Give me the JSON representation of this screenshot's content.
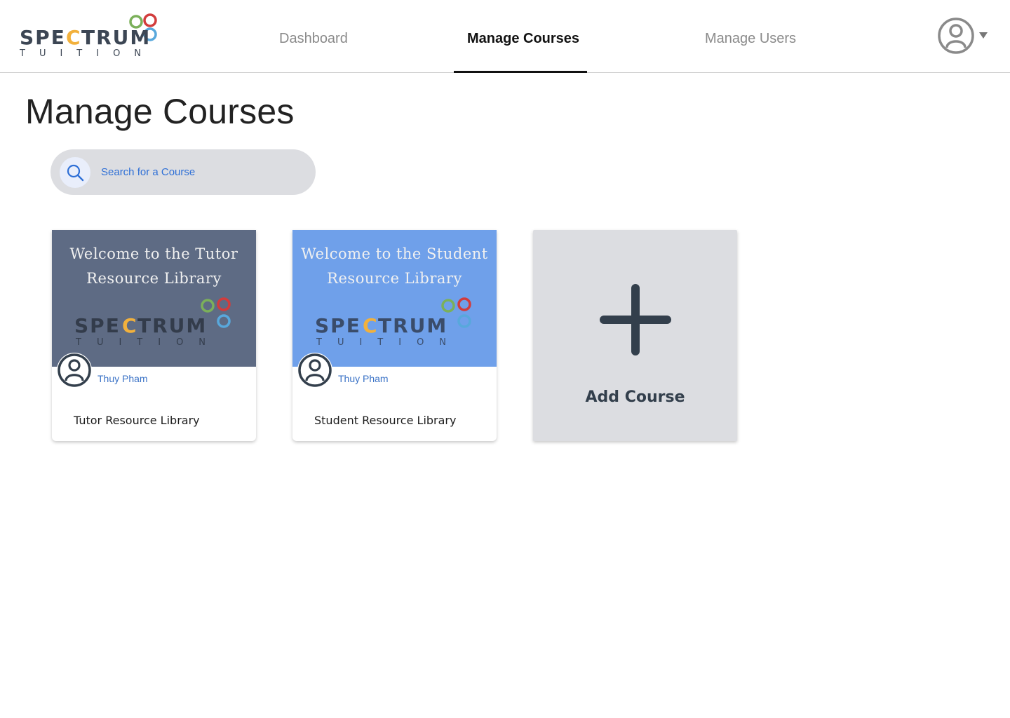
{
  "brand": {
    "name": "SPECTRUM",
    "sub": "TUITION",
    "colors": {
      "green": "#7bb05a",
      "red": "#d23c3c",
      "blue": "#58a8dc",
      "yellow": "#f2b13c",
      "dark": "#3c4654"
    }
  },
  "nav": {
    "items": [
      {
        "label": "Dashboard",
        "active": false
      },
      {
        "label": "Manage Courses",
        "active": true
      },
      {
        "label": "Manage Users",
        "active": false
      }
    ]
  },
  "account": {
    "icon": "user-circle-icon"
  },
  "page": {
    "title": "Manage Courses"
  },
  "search": {
    "placeholder": "Search for a Course",
    "value": ""
  },
  "courses": [
    {
      "banner_line1": "Welcome to the Tutor",
      "banner_line2": "Resource Library",
      "banner_color": "#5e6b84",
      "author": "Thuy Pham",
      "title": "Tutor Resource Library"
    },
    {
      "banner_line1": "Welcome to the Student",
      "banner_line2": "Resource Library",
      "banner_color": "#6fa0ea",
      "author": "Thuy Pham",
      "title": "Student Resource Library"
    }
  ],
  "add_course": {
    "label": "Add Course",
    "icon": "plus-icon"
  }
}
